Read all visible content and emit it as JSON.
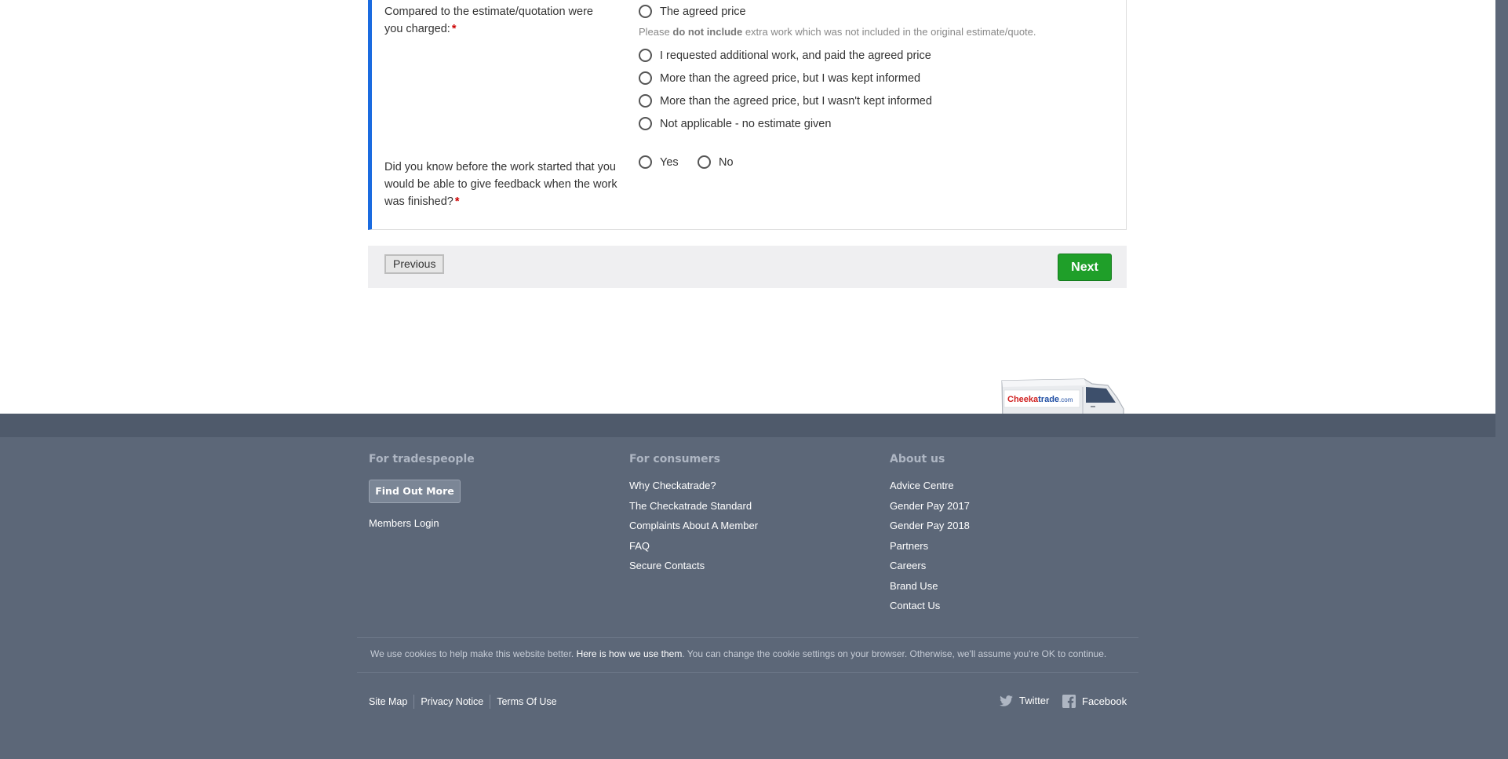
{
  "question1": {
    "label": "Compared to the estimate/quotation were you charged:",
    "required_mark": "*",
    "options": [
      "The agreed price",
      "I requested additional work, and paid the agreed price",
      "More than the agreed price, but I was kept informed",
      "More than the agreed price, but I wasn't kept informed",
      "Not applicable - no estimate given"
    ],
    "hint_prefix": "Please ",
    "hint_bold": "do not include",
    "hint_suffix": " extra work which was not included in the original estimate/quote."
  },
  "question2": {
    "label": "Did you know before the work started that you would be able to give feedback when the work was finished?",
    "required_mark": "*",
    "options": [
      "Yes",
      "No"
    ]
  },
  "nav": {
    "previous": "Previous",
    "next": "Next"
  },
  "van": {
    "brand_red": "Cheeka",
    "brand_blue": "trade",
    "brand_suffix": ".com"
  },
  "footer": {
    "tradespeople": {
      "heading": "For tradespeople",
      "button": "Find Out More",
      "login": "Members Login"
    },
    "consumers": {
      "heading": "For consumers",
      "links": [
        "Why Checkatrade?",
        "The Checkatrade Standard",
        "Complaints About A Member",
        "FAQ",
        "Secure Contacts"
      ]
    },
    "about": {
      "heading": "About us",
      "links": [
        "Advice Centre",
        "Gender Pay 2017",
        "Gender Pay 2018",
        "Partners",
        "Careers",
        "Brand Use",
        "Contact Us"
      ]
    },
    "cookie": {
      "before": "We use cookies to help make this website better. ",
      "link": "Here is how we use them",
      "after": ". You can change the cookie settings on your browser. Otherwise, we'll assume you're OK to continue."
    },
    "bottom_links": [
      "Site Map",
      "Privacy Notice",
      "Terms Of Use"
    ],
    "social": {
      "twitter": "Twitter",
      "facebook": "Facebook"
    }
  },
  "colors": {
    "accent_blue": "#1a6be0",
    "next_green": "#1f9f29",
    "footer_bg": "#5c6778",
    "required_red": "#cc0000"
  }
}
